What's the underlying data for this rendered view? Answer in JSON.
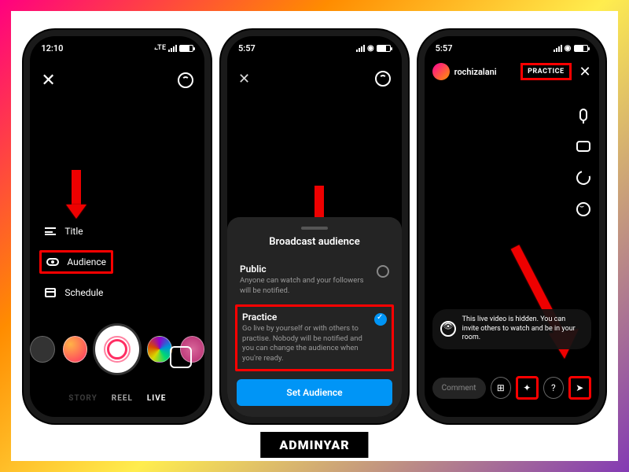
{
  "watermark": "ADMINYAR",
  "screen1": {
    "time": "12:10",
    "carrier": "LTE",
    "menu": {
      "title": "Title",
      "audience": "Audience",
      "schedule": "Schedule"
    },
    "modes": {
      "story": "STORY",
      "reel": "REEL",
      "live": "LIVE"
    }
  },
  "screen2": {
    "time": "5:57",
    "sheet": {
      "title": "Broadcast audience",
      "public": {
        "label": "Public",
        "desc": "Anyone can watch and your followers will be notified."
      },
      "practice": {
        "label": "Practice",
        "desc": "Go live by yourself or with others to practise. Nobody will be notified and you can change the audience when you're ready."
      },
      "button": "Set Audience"
    }
  },
  "screen3": {
    "time": "5:57",
    "username": "rochizalani",
    "badge": "PRACTICE",
    "info": "This live video is hidden. You can invite others to watch and be in your room.",
    "comment_placeholder": "Comment"
  }
}
